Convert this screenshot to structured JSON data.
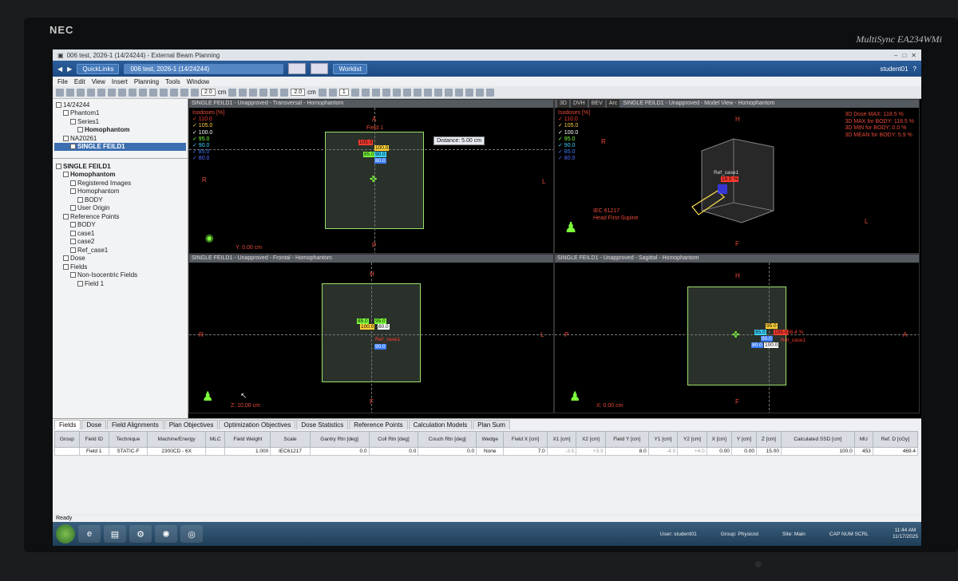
{
  "monitor": {
    "brand": "NEC",
    "model": "MultiSync EA234WMi"
  },
  "window": {
    "title": "006 test, 2026-1 (14/24244) - External Beam Planning"
  },
  "navbar": {
    "quicklinks": "QuickLinks",
    "patient": "006 test, 2026-1  (14/24244)",
    "worklist": "Worklist",
    "user": "student01"
  },
  "menu": [
    "File",
    "Edit",
    "View",
    "Insert",
    "Planning",
    "Tools",
    "Window"
  ],
  "toolbar": {
    "value1": "2.0",
    "unit1": "cm",
    "value2": "2.0",
    "unit2": "cm",
    "value3": "1"
  },
  "tree_top": [
    {
      "label": "14/24244",
      "indent": 0,
      "bold": false
    },
    {
      "label": "Phantom1",
      "indent": 1,
      "bold": false
    },
    {
      "label": "Series1",
      "indent": 2,
      "bold": false
    },
    {
      "label": "Homophantom",
      "indent": 3,
      "bold": true
    },
    {
      "label": "NA20261",
      "indent": 1,
      "bold": false
    },
    {
      "label": "SINGLE FEILD1",
      "indent": 2,
      "bold": true,
      "selected": true
    }
  ],
  "tree_bottom": [
    {
      "label": "SINGLE FEILD1",
      "indent": 0,
      "bold": true
    },
    {
      "label": "Homophantom",
      "indent": 1,
      "bold": true
    },
    {
      "label": "Registered Images",
      "indent": 2,
      "bold": false
    },
    {
      "label": "Homophantom",
      "indent": 2,
      "bold": false
    },
    {
      "label": "BODY",
      "indent": 3,
      "bold": false
    },
    {
      "label": "User Origin",
      "indent": 2,
      "bold": false
    },
    {
      "label": "Reference Points",
      "indent": 1,
      "bold": false
    },
    {
      "label": "BODY",
      "indent": 2,
      "bold": false
    },
    {
      "label": "case1",
      "indent": 2,
      "bold": false
    },
    {
      "label": "case2",
      "indent": 2,
      "bold": false
    },
    {
      "label": "Ref_case1",
      "indent": 2,
      "bold": false
    },
    {
      "label": "Dose",
      "indent": 1,
      "bold": false
    },
    {
      "label": "Fields",
      "indent": 1,
      "bold": false
    },
    {
      "label": "Non-Isocentric Fields",
      "indent": 2,
      "bold": false
    },
    {
      "label": "Field 1",
      "indent": 3,
      "bold": false
    }
  ],
  "isodoses": {
    "header": "Isodoses [%]",
    "levels": [
      "110.0",
      "105.0",
      "100.0",
      "95.0",
      "90.0",
      "85.0",
      "80.0"
    ],
    "colors": [
      "#ff3b2f",
      "#ffd23a",
      "#ffffff",
      "#7dff3a",
      "#3ad2ff",
      "#3a7dff",
      "#5a6cff"
    ]
  },
  "views": {
    "transversal": {
      "title": "SINGLE FEILD1 - Unapproved - Transversal - Homophantom",
      "top": "A",
      "bottom": "P",
      "left": "R",
      "right": "L",
      "coord": "Y: 0.00 cm",
      "distance": "Distance: 5.00 cm",
      "field": "Field 1"
    },
    "model": {
      "tabs": [
        "3D",
        "DVH",
        "BEV",
        "Arc"
      ],
      "title": "SINGLE FEILD1 - Unapproved - Model View - Homophantom",
      "top": "H",
      "bottom": "F",
      "left": "R",
      "right": "L",
      "iec": "IEC 61217",
      "orientation": "Head First-Supine",
      "ref": "Ref_case1",
      "refval": "18.5 %",
      "info": [
        "3D Dose MAX: 118.5 %",
        "3D MAX for BODY: 118.5 %",
        "3D MIN for BODY: 0.0 %",
        "3D MEAN for BODY: 5.9 %"
      ]
    },
    "frontal": {
      "title": "SINGLE FEILD1 - Unapproved - Frontal - Homophantom",
      "top": "H",
      "bottom": "F",
      "left": "R",
      "right": "L",
      "coord": "Z: 10.00 cm"
    },
    "sagittal": {
      "title": "SINGLE FEILD1 - Unapproved - Sagittal - Homophantom",
      "top": "H",
      "bottom": "F",
      "left": "P",
      "right": "A",
      "coord": "X: 0.00 cm",
      "dose": "88.4 %"
    }
  },
  "bottom_tabs": [
    "Fields",
    "Dose",
    "Field Alignments",
    "Plan Objectives",
    "Optimization Objectives",
    "Dose Statistics",
    "Reference Points",
    "Calculation Models",
    "Plan Sum"
  ],
  "table": {
    "headers": [
      "Group",
      "Field ID",
      "Technique",
      "Machine/Energy",
      "MLC",
      "Field Weight",
      "Scale",
      "Gantry Rtn [deg]",
      "Coll Rtn [deg]",
      "Couch Rtn [deg]",
      "Wedge",
      "Field X [cm]",
      "X1 [cm]",
      "X2 [cm]",
      "Field Y [cm]",
      "Y1 [cm]",
      "Y2 [cm]",
      "X [cm]",
      "Y [cm]",
      "Z [cm]",
      "Calculated SSD [cm]",
      "MU",
      "Ref. D [cGy]"
    ],
    "rows": [
      [
        "",
        "Field 1",
        "STATIC-F",
        "2300CD - 6X",
        "",
        "1.000",
        "IEC61217",
        "0.0",
        "0.0",
        "0.0",
        "None",
        "7.0",
        "-3.5",
        "+3.5",
        "8.0",
        "-4.0",
        "+4.0",
        "0.00",
        "0.00",
        "15.00",
        "100.0",
        "453",
        "469.4"
      ]
    ]
  },
  "status": {
    "ready": "Ready",
    "user": "User: student01",
    "group": "Group: Physicist",
    "site": "Site: Main",
    "keys": "CAP NUM SCRL",
    "time": "11:44 AM",
    "date": "11/17/2025"
  }
}
